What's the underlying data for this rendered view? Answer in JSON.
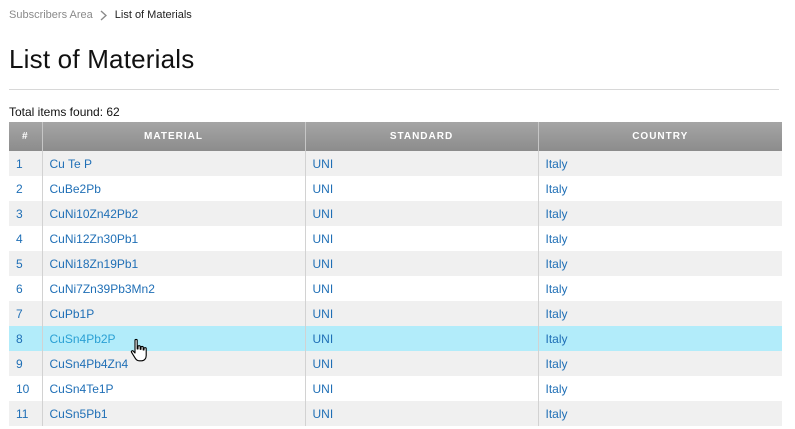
{
  "breadcrumb": {
    "parent": "Subscribers Area",
    "current": "List of Materials"
  },
  "page": {
    "title": "List of Materials",
    "total": "Total items found: 62"
  },
  "table": {
    "headers": {
      "index": "#",
      "material": "MATERIAL",
      "standard": "STANDARD",
      "country": "COUNTRY"
    },
    "rows": [
      {
        "n": "1",
        "material": "Cu Te P",
        "standard": "UNI",
        "country": "Italy"
      },
      {
        "n": "2",
        "material": "CuBe2Pb",
        "standard": "UNI",
        "country": "Italy"
      },
      {
        "n": "3",
        "material": "CuNi10Zn42Pb2",
        "standard": "UNI",
        "country": "Italy"
      },
      {
        "n": "4",
        "material": "CuNi12Zn30Pb1",
        "standard": "UNI",
        "country": "Italy"
      },
      {
        "n": "5",
        "material": "CuNi18Zn19Pb1",
        "standard": "UNI",
        "country": "Italy"
      },
      {
        "n": "6",
        "material": "CuNi7Zn39Pb3Mn2",
        "standard": "UNI",
        "country": "Italy"
      },
      {
        "n": "7",
        "material": "CuPb1P",
        "standard": "UNI",
        "country": "Italy"
      },
      {
        "n": "8",
        "material": "CuSn4Pb2P",
        "standard": "UNI",
        "country": "Italy"
      },
      {
        "n": "9",
        "material": "CuSn4Pb4Zn4",
        "standard": "UNI",
        "country": "Italy"
      },
      {
        "n": "10",
        "material": "CuSn4Te1P",
        "standard": "UNI",
        "country": "Italy"
      },
      {
        "n": "11",
        "material": "CuSn5Pb1",
        "standard": "UNI",
        "country": "Italy"
      }
    ]
  },
  "colors": {
    "link": "#1f6fb6",
    "highlight_row": "#b2ecfa",
    "header_bg": "#999999"
  },
  "icons": {
    "separator": "chevron-right-icon",
    "cursor": "hand-pointer-cursor-icon"
  }
}
